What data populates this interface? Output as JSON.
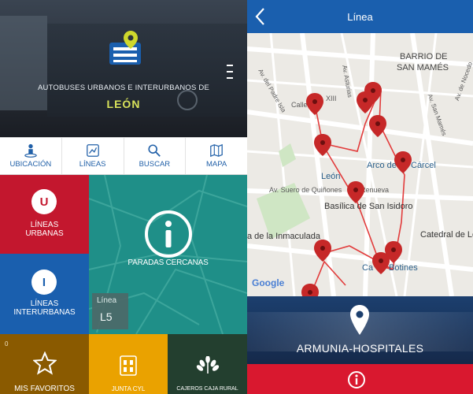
{
  "left": {
    "hero": {
      "subtitle": "AUTOBUSES URBANOS E INTERURBANOS DE",
      "city": "LEÓN"
    },
    "nav": [
      {
        "label": "UBICACIÓN",
        "icon": "person-location-icon"
      },
      {
        "label": "LÍNEAS",
        "icon": "route-map-icon"
      },
      {
        "label": "BUSCAR",
        "icon": "search-icon"
      },
      {
        "label": "MAPA",
        "icon": "map-icon"
      }
    ],
    "tiles": {
      "urbanas": {
        "line1": "LÍNEAS",
        "line2": "URBANAS",
        "icon": "bus-urban-icon",
        "color": "#c3172e"
      },
      "interurbanas": {
        "line1": "LÍNEAS",
        "line2": "INTERURBANAS",
        "icon": "bus-intercity-icon",
        "color": "#1a5fae"
      },
      "paradas": {
        "label": "PARADAS CERCANAS",
        "icon": "info-icon",
        "color": "#1f8f88"
      },
      "linea": {
        "label": "Línea",
        "value": "L5"
      },
      "favoritos": {
        "label": "MIS FAVORITOS",
        "count": "0",
        "icon": "star-icon"
      },
      "junta": {
        "label": "JUNTA CYL",
        "icon": "castle-seal-icon"
      },
      "caja": {
        "label": "CAJEROS CAJA RURAL",
        "icon": "wheat-logo-icon"
      }
    }
  },
  "right": {
    "header": {
      "title": "Línea",
      "back_icon": "back-chevron-icon"
    },
    "map": {
      "labels": {
        "barrio": "BARRIO DE",
        "mames": "SAN MAMÉS",
        "asturias": "Av. Asturias",
        "padre_isla": "Av. del Padre Isla",
        "san_mames": "Av. San Mamés",
        "nocedo": "Av. de Nocedo",
        "calle": "Calle",
        "xiii": "XIII",
        "arco": "Arco de",
        "carcel": "Cárcel",
        "leon": "León",
        "suero": "Av. Suero de Quiñones",
        "renueva": "Renueva",
        "basilica": "Basílica de San Isidoro",
        "inmaculada": "a de la Inmaculada",
        "catedral": "Catedral de Le",
        "casa": "Ca",
        "botines": "Botines",
        "google": "Google"
      }
    },
    "stop": {
      "name": "ARMUNIA-HOSPITALES",
      "icon": "location-pin-icon"
    },
    "info_button_icon": "info-icon"
  },
  "colors": {
    "primary_blue": "#1a5fae",
    "red": "#d9182f",
    "teal": "#1f8f88",
    "yellow": "#eaa200",
    "accent_lime": "#d8e25a"
  }
}
